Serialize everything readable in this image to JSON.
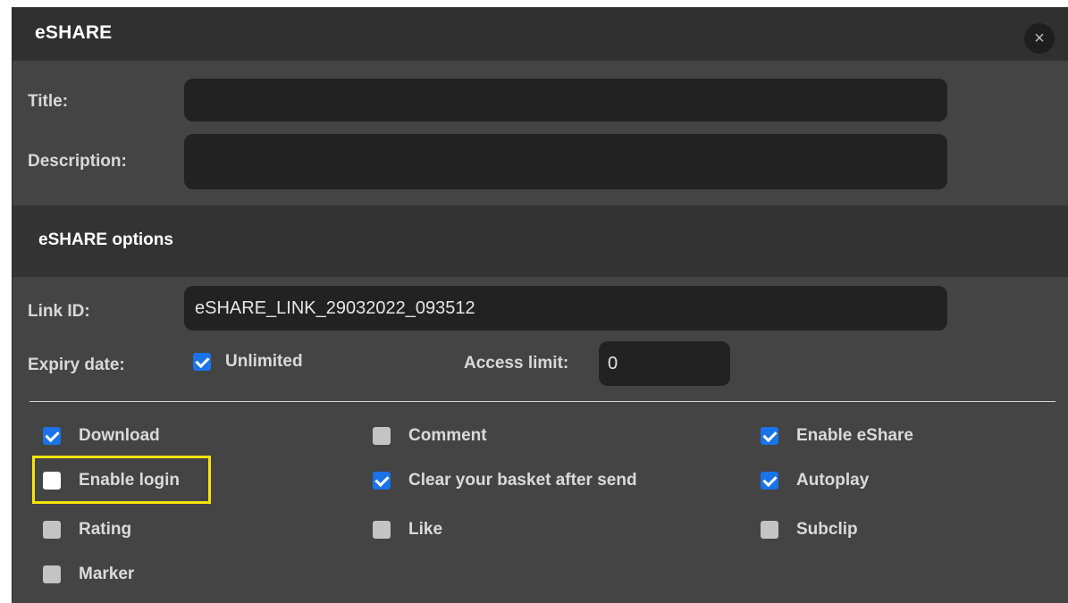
{
  "dialog": {
    "title": "eSHARE",
    "close_icon": "×"
  },
  "form": {
    "title_label": "Title:",
    "title_value": "",
    "description_label": "Description:",
    "description_value": ""
  },
  "options": {
    "section_title": "eSHARE options",
    "link_id_label": "Link ID:",
    "link_id_value": "eSHARE_LINK_29032022_093512",
    "expiry_label": "Expiry date:",
    "unlimited_label": "Unlimited",
    "unlimited_checked": true,
    "access_limit_label": "Access limit:",
    "access_limit_value": "0"
  },
  "checkboxes": {
    "download": {
      "label": "Download",
      "checked": true
    },
    "enable_login": {
      "label": "Enable login",
      "checked": false
    },
    "rating": {
      "label": "Rating",
      "checked": false
    },
    "marker": {
      "label": "Marker",
      "checked": false
    },
    "comment": {
      "label": "Comment",
      "checked": false
    },
    "clear_basket": {
      "label": "Clear your basket after send",
      "checked": true
    },
    "like": {
      "label": "Like",
      "checked": false
    },
    "enable_eshare": {
      "label": "Enable eShare",
      "checked": true
    },
    "autoplay": {
      "label": "Autoplay",
      "checked": true
    },
    "subclip": {
      "label": "Subclip",
      "checked": false
    }
  },
  "colors": {
    "checkbox_checked": "#1a73e8",
    "highlight": "#f5e50b",
    "dialog_bg": "#444444",
    "header_bg": "#303030"
  }
}
